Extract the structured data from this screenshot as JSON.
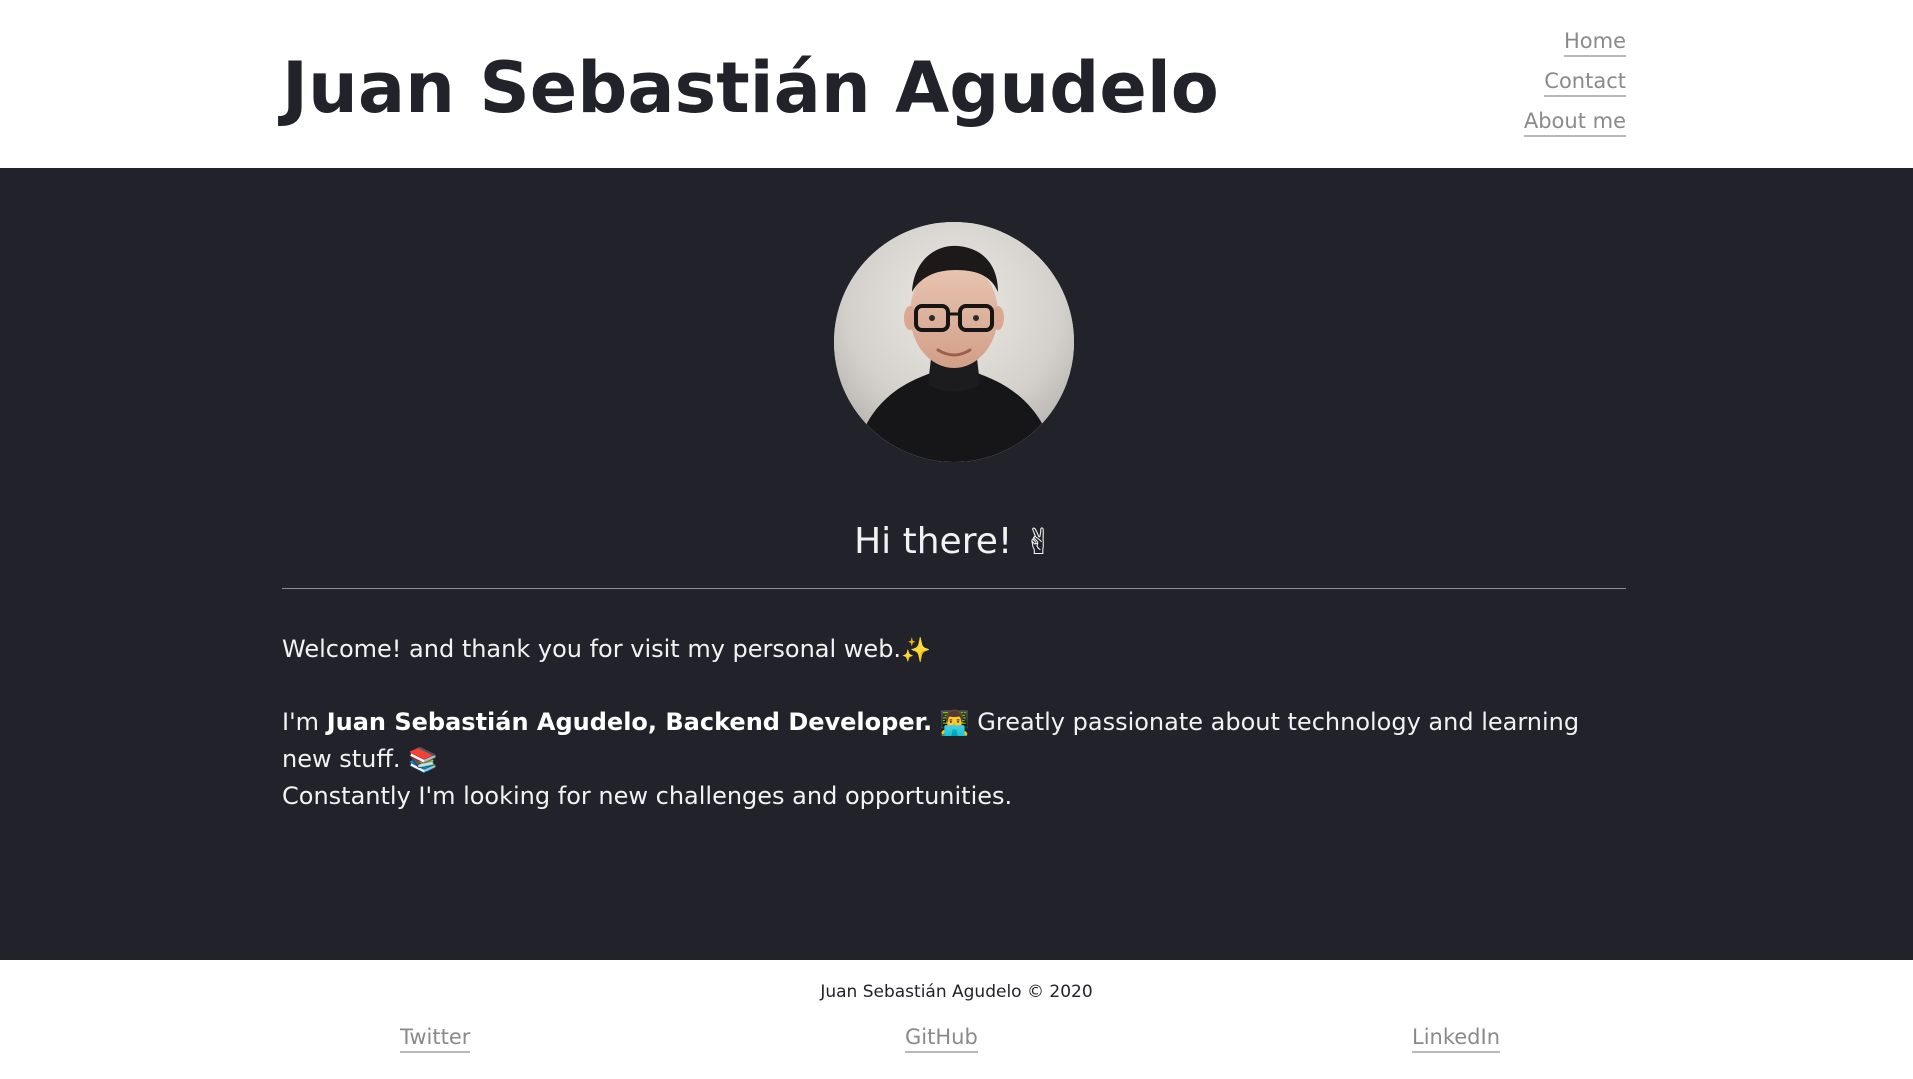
{
  "header": {
    "title": "Juan Sebastián Agudelo",
    "nav": {
      "home": "Home",
      "contact": "Contact",
      "about": "About me"
    }
  },
  "main": {
    "greeting": "Hi there!",
    "greeting_emoji": "✌",
    "welcome_line": "Welcome! and thank you for visit my personal web.",
    "welcome_emoji": "✨",
    "bio_prefix": "I'm ",
    "bio_name": "Juan Sebastián Agudelo, Backend Developer.",
    "bio_emoji": "👨‍💻",
    "bio_passion": " Greatly passionate about technology and learning new stuff.",
    "bio_emoji_books": "📚",
    "bio_closing": "Constantly I'm looking for new challenges and opportunities."
  },
  "footer": {
    "copyright": "Juan Sebastián Agudelo © 2020",
    "links": {
      "twitter": "Twitter",
      "github": "GitHub",
      "linkedin": "LinkedIn"
    }
  },
  "colors": {
    "dark_bg": "#22222a",
    "light_bg": "#ffffff",
    "link_gray": "#8a8a8a",
    "text_light": "#f2f2f2"
  },
  "icons": {
    "greeting": "victory-hand-icon",
    "welcome": "sparkles-icon",
    "developer": "technologist-icon",
    "books": "books-icon"
  }
}
